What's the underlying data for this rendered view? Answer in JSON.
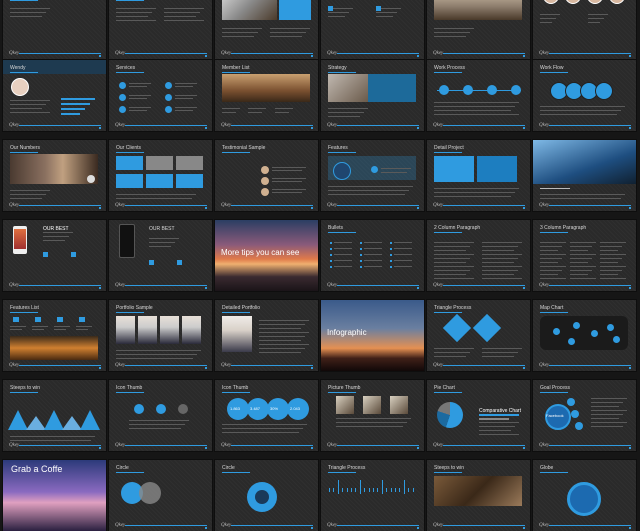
{
  "theme": {
    "accent": "#2f9be0",
    "background": "#161616",
    "slide_bg": "#2a2a2a"
  },
  "logo_text": "Qkey",
  "slides": [
    {
      "title": "Welcome"
    },
    {
      "title": "About Us"
    },
    {
      "title": ""
    },
    {
      "title": ""
    },
    {
      "title": ""
    },
    {
      "title": ""
    },
    {
      "title": "Wendy"
    },
    {
      "title": "Services"
    },
    {
      "title": "Member List"
    },
    {
      "title": "Strategy"
    },
    {
      "title": "Work Process"
    },
    {
      "title": "Work Flow"
    },
    {
      "title": "Our Numbers"
    },
    {
      "title": "Our Clients"
    },
    {
      "title": "Testimonial Sample"
    },
    {
      "title": "Features"
    },
    {
      "title": "Detail Project"
    },
    {
      "title": ""
    },
    {
      "title": ""
    },
    {
      "title": "OUR BEST"
    },
    {
      "title": "More tips you can see",
      "overlay": true
    },
    {
      "title": "Bullets"
    },
    {
      "title": "2 Column Paragraph"
    },
    {
      "title": "3 Column Paragraph"
    },
    {
      "title": "Features List"
    },
    {
      "title": "Portfolio Sample"
    },
    {
      "title": "Detailed Portfolio"
    },
    {
      "title": "Infographic",
      "overlay": true
    },
    {
      "title": "Triangle Process"
    },
    {
      "title": "Map Chart"
    },
    {
      "title": "Steeps to win"
    },
    {
      "title": "Icon Thumb"
    },
    {
      "title": "Icon Thumb"
    },
    {
      "title": "Picture Thumb"
    },
    {
      "title": "Pie Chart"
    },
    {
      "title": "Goal Process"
    },
    {
      "title": "Grab a Coffe",
      "overlay": true
    },
    {
      "title": "Circle"
    },
    {
      "title": "Circle"
    },
    {
      "title": "Triangle Process"
    },
    {
      "title": "Steeps to win"
    },
    {
      "title": "Globe"
    }
  ],
  "extras": {
    "our_best": "OUR BEST",
    "comparative_chart": "Comparative Chart",
    "facebook": "Facebook",
    "stats": [
      "1.863",
      "3.487",
      "30%",
      "2.043"
    ]
  }
}
